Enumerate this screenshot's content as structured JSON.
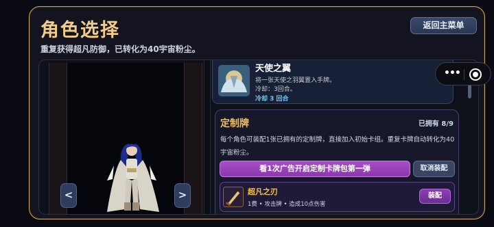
{
  "modal": {
    "title": "角色选择",
    "subtitle": "重复获得超凡防御，已转化为40宇宙粉尘。",
    "back_label": "返回主菜单"
  },
  "character_panel": {
    "prev_label": "<",
    "next_label": ">"
  },
  "card_top": {
    "name": "天使之翼",
    "desc": "将一张天使之羽翼置入手牌。",
    "cooldown": "冷却：3回合。",
    "cooldown_tag": "冷却 3 回合"
  },
  "custom_section": {
    "title": "定制牌",
    "owned": "已拥有 8/9",
    "desc": "每个角色可装配1张已拥有的定制牌，直接加入初始卡组。重复卡牌自动转化为40宇宙粉尘。",
    "ad_button": "看1次广告开启定制卡牌包第一弹",
    "cancel_button": "取消装配",
    "card": {
      "name": "超凡之刃",
      "meta": "1费 • 攻击牌 • 造成10点伤害",
      "equip_button": "装配"
    }
  },
  "colors": {
    "accent_gold": "#f2cd8a",
    "frame_gold": "#c9a35a",
    "purple_button": "#a74fc7",
    "cooldown_blue": "#7ac3ee"
  },
  "icons": {
    "capsule_menu": "more-dots-icon",
    "capsule_close": "target-close-icon"
  }
}
